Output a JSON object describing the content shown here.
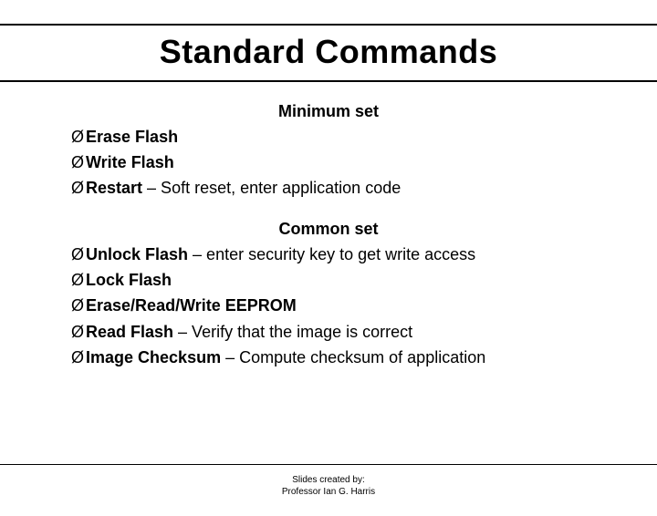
{
  "title": "Standard Commands",
  "sections": {
    "min": {
      "heading": "Minimum set",
      "items": [
        {
          "cmd": "Erase Flash",
          "desc": ""
        },
        {
          "cmd": "Write Flash",
          "desc": ""
        },
        {
          "cmd": "Restart",
          "desc": " – Soft reset, enter application code"
        }
      ]
    },
    "common": {
      "heading": "Common set",
      "items": [
        {
          "cmd": "Unlock Flash",
          "desc": " – enter security key to get write access"
        },
        {
          "cmd": "Lock Flash",
          "desc": ""
        },
        {
          "cmd": "Erase/Read/Write EEPROM",
          "desc": ""
        },
        {
          "cmd": "Read Flash",
          "desc": " – Verify that the image is correct"
        },
        {
          "cmd": "Image Checksum",
          "desc": " – Compute checksum of application"
        }
      ]
    }
  },
  "bullet_glyph": "Ø",
  "footer": {
    "line1": "Slides created by:",
    "line2": "Professor Ian G. Harris"
  }
}
